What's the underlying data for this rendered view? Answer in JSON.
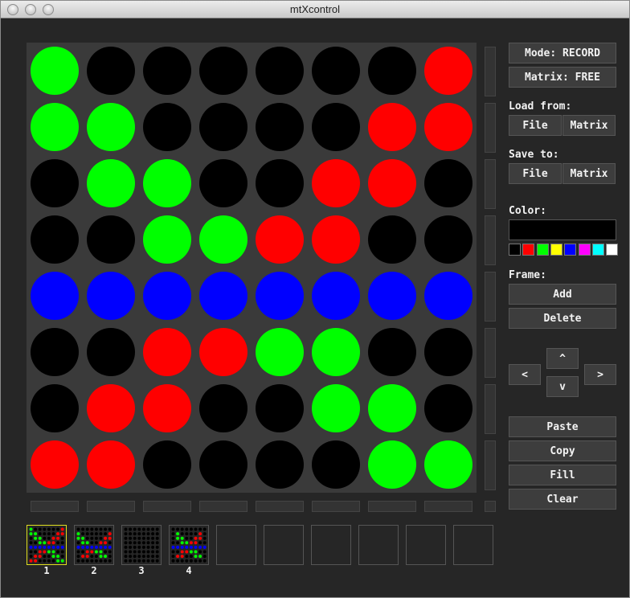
{
  "window": {
    "title": "mtXcontrol"
  },
  "colors": {
    "K": "#000000",
    "G": "#00ff00",
    "R": "#ff0000",
    "B": "#0000ff"
  },
  "matrix": {
    "rows": [
      [
        "G",
        "K",
        "K",
        "K",
        "K",
        "K",
        "K",
        "R"
      ],
      [
        "G",
        "G",
        "K",
        "K",
        "K",
        "K",
        "R",
        "R"
      ],
      [
        "K",
        "G",
        "G",
        "K",
        "K",
        "R",
        "R",
        "K"
      ],
      [
        "K",
        "K",
        "G",
        "G",
        "R",
        "R",
        "K",
        "K"
      ],
      [
        "B",
        "B",
        "B",
        "B",
        "B",
        "B",
        "B",
        "B"
      ],
      [
        "K",
        "K",
        "R",
        "R",
        "G",
        "G",
        "K",
        "K"
      ],
      [
        "K",
        "R",
        "R",
        "K",
        "K",
        "G",
        "G",
        "K"
      ],
      [
        "R",
        "R",
        "K",
        "K",
        "K",
        "K",
        "G",
        "G"
      ]
    ]
  },
  "controls": {
    "mode_label": "Mode: RECORD",
    "matrix_label": "Matrix: FREE",
    "load_from_label": "Load from:",
    "load_file": "File",
    "load_matrix": "Matrix",
    "save_to_label": "Save to:",
    "save_file": "File",
    "save_matrix": "Matrix",
    "color_label": "Color:",
    "current_color": "#000000",
    "palette": [
      {
        "name": "black",
        "hex": "#000000"
      },
      {
        "name": "red",
        "hex": "#ff0000"
      },
      {
        "name": "green",
        "hex": "#00ff00"
      },
      {
        "name": "yellow",
        "hex": "#ffff00"
      },
      {
        "name": "blue",
        "hex": "#0000ff"
      },
      {
        "name": "magenta",
        "hex": "#ff00ff"
      },
      {
        "name": "cyan",
        "hex": "#00ffff"
      },
      {
        "name": "white",
        "hex": "#ffffff"
      }
    ],
    "frame_label": "Frame:",
    "add": "Add",
    "delete": "Delete",
    "up": "^",
    "down": "v",
    "left": "<",
    "right": ">",
    "paste": "Paste",
    "copy": "Copy",
    "fill": "Fill",
    "clear": "Clear"
  },
  "frames": {
    "labels": [
      "1",
      "2",
      "3",
      "4"
    ],
    "selected": 0,
    "total_slots": 10,
    "frame_data": [
      [
        [
          "G",
          "K",
          "K",
          "K",
          "K",
          "K",
          "K",
          "R"
        ],
        [
          "G",
          "G",
          "K",
          "K",
          "K",
          "K",
          "R",
          "R"
        ],
        [
          "K",
          "G",
          "G",
          "K",
          "K",
          "R",
          "R",
          "K"
        ],
        [
          "K",
          "K",
          "G",
          "G",
          "R",
          "R",
          "K",
          "K"
        ],
        [
          "B",
          "B",
          "B",
          "B",
          "B",
          "B",
          "B",
          "B"
        ],
        [
          "K",
          "K",
          "R",
          "R",
          "G",
          "G",
          "K",
          "K"
        ],
        [
          "K",
          "R",
          "R",
          "K",
          "K",
          "G",
          "G",
          "K"
        ],
        [
          "R",
          "R",
          "K",
          "K",
          "K",
          "K",
          "G",
          "G"
        ]
      ],
      [
        [
          "K",
          "K",
          "K",
          "K",
          "K",
          "K",
          "K",
          "K"
        ],
        [
          "G",
          "K",
          "K",
          "K",
          "K",
          "K",
          "K",
          "R"
        ],
        [
          "G",
          "G",
          "K",
          "K",
          "K",
          "K",
          "R",
          "R"
        ],
        [
          "K",
          "G",
          "G",
          "K",
          "K",
          "R",
          "R",
          "K"
        ],
        [
          "B",
          "B",
          "B",
          "B",
          "B",
          "B",
          "B",
          "B"
        ],
        [
          "K",
          "K",
          "R",
          "R",
          "G",
          "G",
          "K",
          "K"
        ],
        [
          "K",
          "R",
          "R",
          "K",
          "K",
          "G",
          "G",
          "K"
        ],
        [
          "K",
          "K",
          "K",
          "K",
          "K",
          "K",
          "K",
          "K"
        ]
      ],
      [
        [
          "K",
          "K",
          "K",
          "K",
          "K",
          "K",
          "K",
          "K"
        ],
        [
          "K",
          "K",
          "K",
          "K",
          "K",
          "K",
          "K",
          "K"
        ],
        [
          "K",
          "K",
          "K",
          "K",
          "K",
          "K",
          "K",
          "K"
        ],
        [
          "K",
          "K",
          "K",
          "K",
          "K",
          "K",
          "K",
          "K"
        ],
        [
          "K",
          "K",
          "K",
          "K",
          "K",
          "K",
          "K",
          "K"
        ],
        [
          "K",
          "K",
          "K",
          "K",
          "K",
          "K",
          "K",
          "K"
        ],
        [
          "K",
          "K",
          "K",
          "K",
          "K",
          "K",
          "K",
          "K"
        ],
        [
          "K",
          "K",
          "K",
          "K",
          "K",
          "K",
          "K",
          "K"
        ]
      ],
      [
        [
          "K",
          "K",
          "K",
          "K",
          "K",
          "K",
          "K",
          "K"
        ],
        [
          "K",
          "G",
          "K",
          "K",
          "K",
          "K",
          "R",
          "K"
        ],
        [
          "K",
          "G",
          "G",
          "K",
          "K",
          "R",
          "R",
          "K"
        ],
        [
          "K",
          "K",
          "G",
          "G",
          "R",
          "R",
          "K",
          "K"
        ],
        [
          "B",
          "B",
          "B",
          "B",
          "B",
          "B",
          "B",
          "B"
        ],
        [
          "K",
          "K",
          "R",
          "R",
          "G",
          "G",
          "K",
          "K"
        ],
        [
          "K",
          "R",
          "R",
          "K",
          "K",
          "G",
          "G",
          "K"
        ],
        [
          "K",
          "K",
          "K",
          "K",
          "K",
          "K",
          "K",
          "K"
        ]
      ]
    ]
  }
}
